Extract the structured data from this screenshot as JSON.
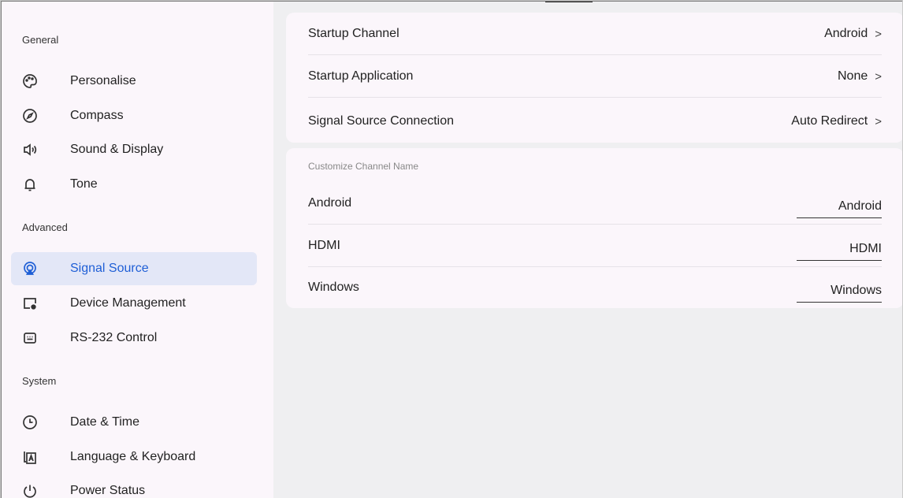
{
  "sidebar": {
    "sections": [
      {
        "title": "General"
      },
      {
        "title": "Advanced"
      },
      {
        "title": "System"
      }
    ],
    "items": [
      {
        "label": "Personalise",
        "icon": "palette-icon"
      },
      {
        "label": "Compass",
        "icon": "compass-icon"
      },
      {
        "label": "Sound & Display",
        "icon": "speaker-icon"
      },
      {
        "label": "Tone",
        "icon": "bell-icon"
      },
      {
        "label": "Signal Source",
        "icon": "signal-source-icon",
        "active": true
      },
      {
        "label": "Device Management",
        "icon": "device-management-icon"
      },
      {
        "label": "RS-232 Control",
        "icon": "keyboard-port-icon"
      },
      {
        "label": "Date & Time",
        "icon": "clock-icon"
      },
      {
        "label": "Language & Keyboard",
        "icon": "language-icon"
      },
      {
        "label": "Power Status",
        "icon": "power-icon"
      }
    ]
  },
  "startup": {
    "rows": [
      {
        "label": "Startup Channel",
        "value": "Android"
      },
      {
        "label": "Startup Application",
        "value": "None"
      },
      {
        "label": "Signal Source Connection",
        "value": "Auto Redirect"
      }
    ],
    "chevron": ">"
  },
  "channel_names": {
    "title": "Customize Channel Name",
    "rows": [
      {
        "label": "Android",
        "value": "Android"
      },
      {
        "label": "HDMI",
        "value": "HDMI"
      },
      {
        "label": "Windows",
        "value": "Windows"
      }
    ]
  },
  "colors": {
    "accent": "#1f5fd6",
    "active_bg": "#e3e7f7",
    "panel_bg": "#fbf6fb",
    "page_bg": "#efeff1"
  }
}
